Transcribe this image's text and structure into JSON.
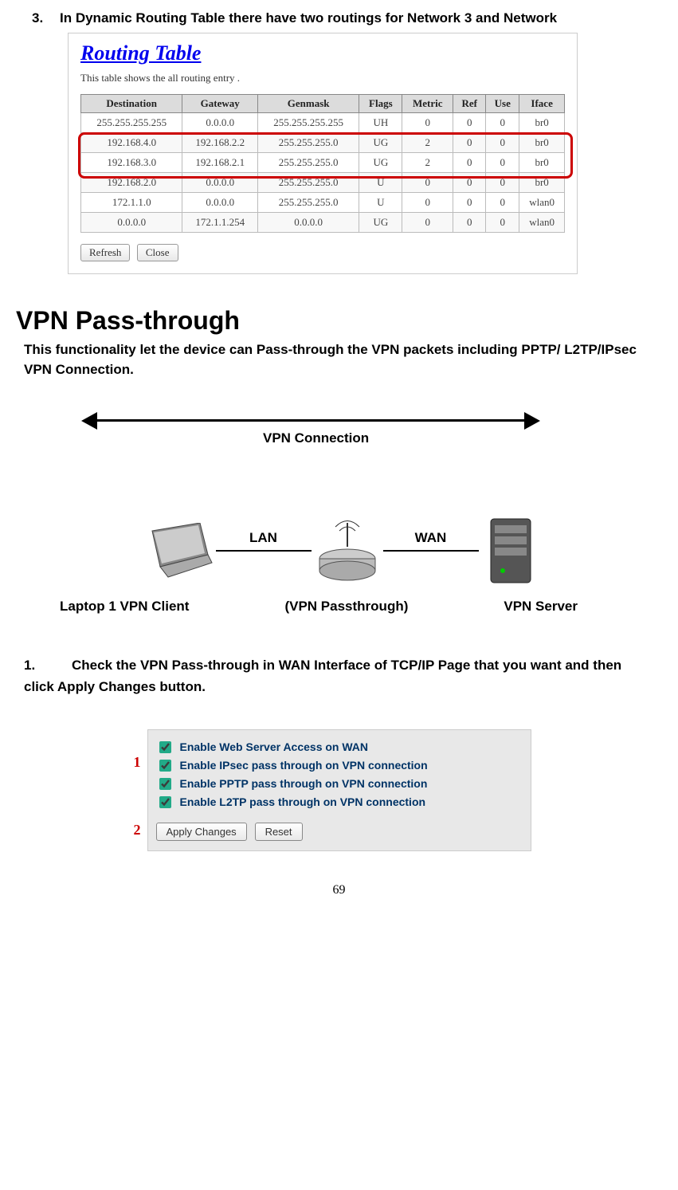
{
  "intro": {
    "number": "3.",
    "text": "In Dynamic Routing Table there have two routings for Network 3 and Network"
  },
  "routing_table": {
    "title": "Routing Table",
    "subtitle": "This table shows the all routing entry .",
    "headers": [
      "Destination",
      "Gateway",
      "Genmask",
      "Flags",
      "Metric",
      "Ref",
      "Use",
      "Iface"
    ],
    "rows": [
      [
        "255.255.255.255",
        "0.0.0.0",
        "255.255.255.255",
        "UH",
        "0",
        "0",
        "0",
        "br0"
      ],
      [
        "192.168.4.0",
        "192.168.2.2",
        "255.255.255.0",
        "UG",
        "2",
        "0",
        "0",
        "br0"
      ],
      [
        "192.168.3.0",
        "192.168.2.1",
        "255.255.255.0",
        "UG",
        "2",
        "0",
        "0",
        "br0"
      ],
      [
        "192.168.2.0",
        "0.0.0.0",
        "255.255.255.0",
        "U",
        "0",
        "0",
        "0",
        "br0"
      ],
      [
        "172.1.1.0",
        "0.0.0.0",
        "255.255.255.0",
        "U",
        "0",
        "0",
        "0",
        "wlan0"
      ],
      [
        "0.0.0.0",
        "172.1.1.254",
        "0.0.0.0",
        "UG",
        "0",
        "0",
        "0",
        "wlan0"
      ]
    ],
    "refresh": "Refresh",
    "close": "Close"
  },
  "vpn": {
    "heading": "VPN Pass-through",
    "description": "This functionality let the device can Pass-through the VPN packets including PPTP/ L2TP/IPsec VPN Connection.",
    "conn_label": "VPN Connection",
    "lan": "LAN",
    "wan": "WAN",
    "label_client": "Laptop 1 VPN Client",
    "label_pass": "(VPN Passthrough)",
    "label_server": "VPN Server",
    "step1_num": "1.",
    "step1_text": "Check the VPN Pass-through in WAN Interface of TCP/IP Page that you want and then click Apply Changes button."
  },
  "check_panel": {
    "callout1": "1",
    "callout2": "2",
    "options": [
      "Enable Web Server Access on WAN",
      "Enable IPsec pass through on VPN connection",
      "Enable PPTP pass through on VPN connection",
      "Enable L2TP pass through on VPN connection"
    ],
    "apply": "Apply Changes",
    "reset": "Reset"
  },
  "page_number": "69"
}
